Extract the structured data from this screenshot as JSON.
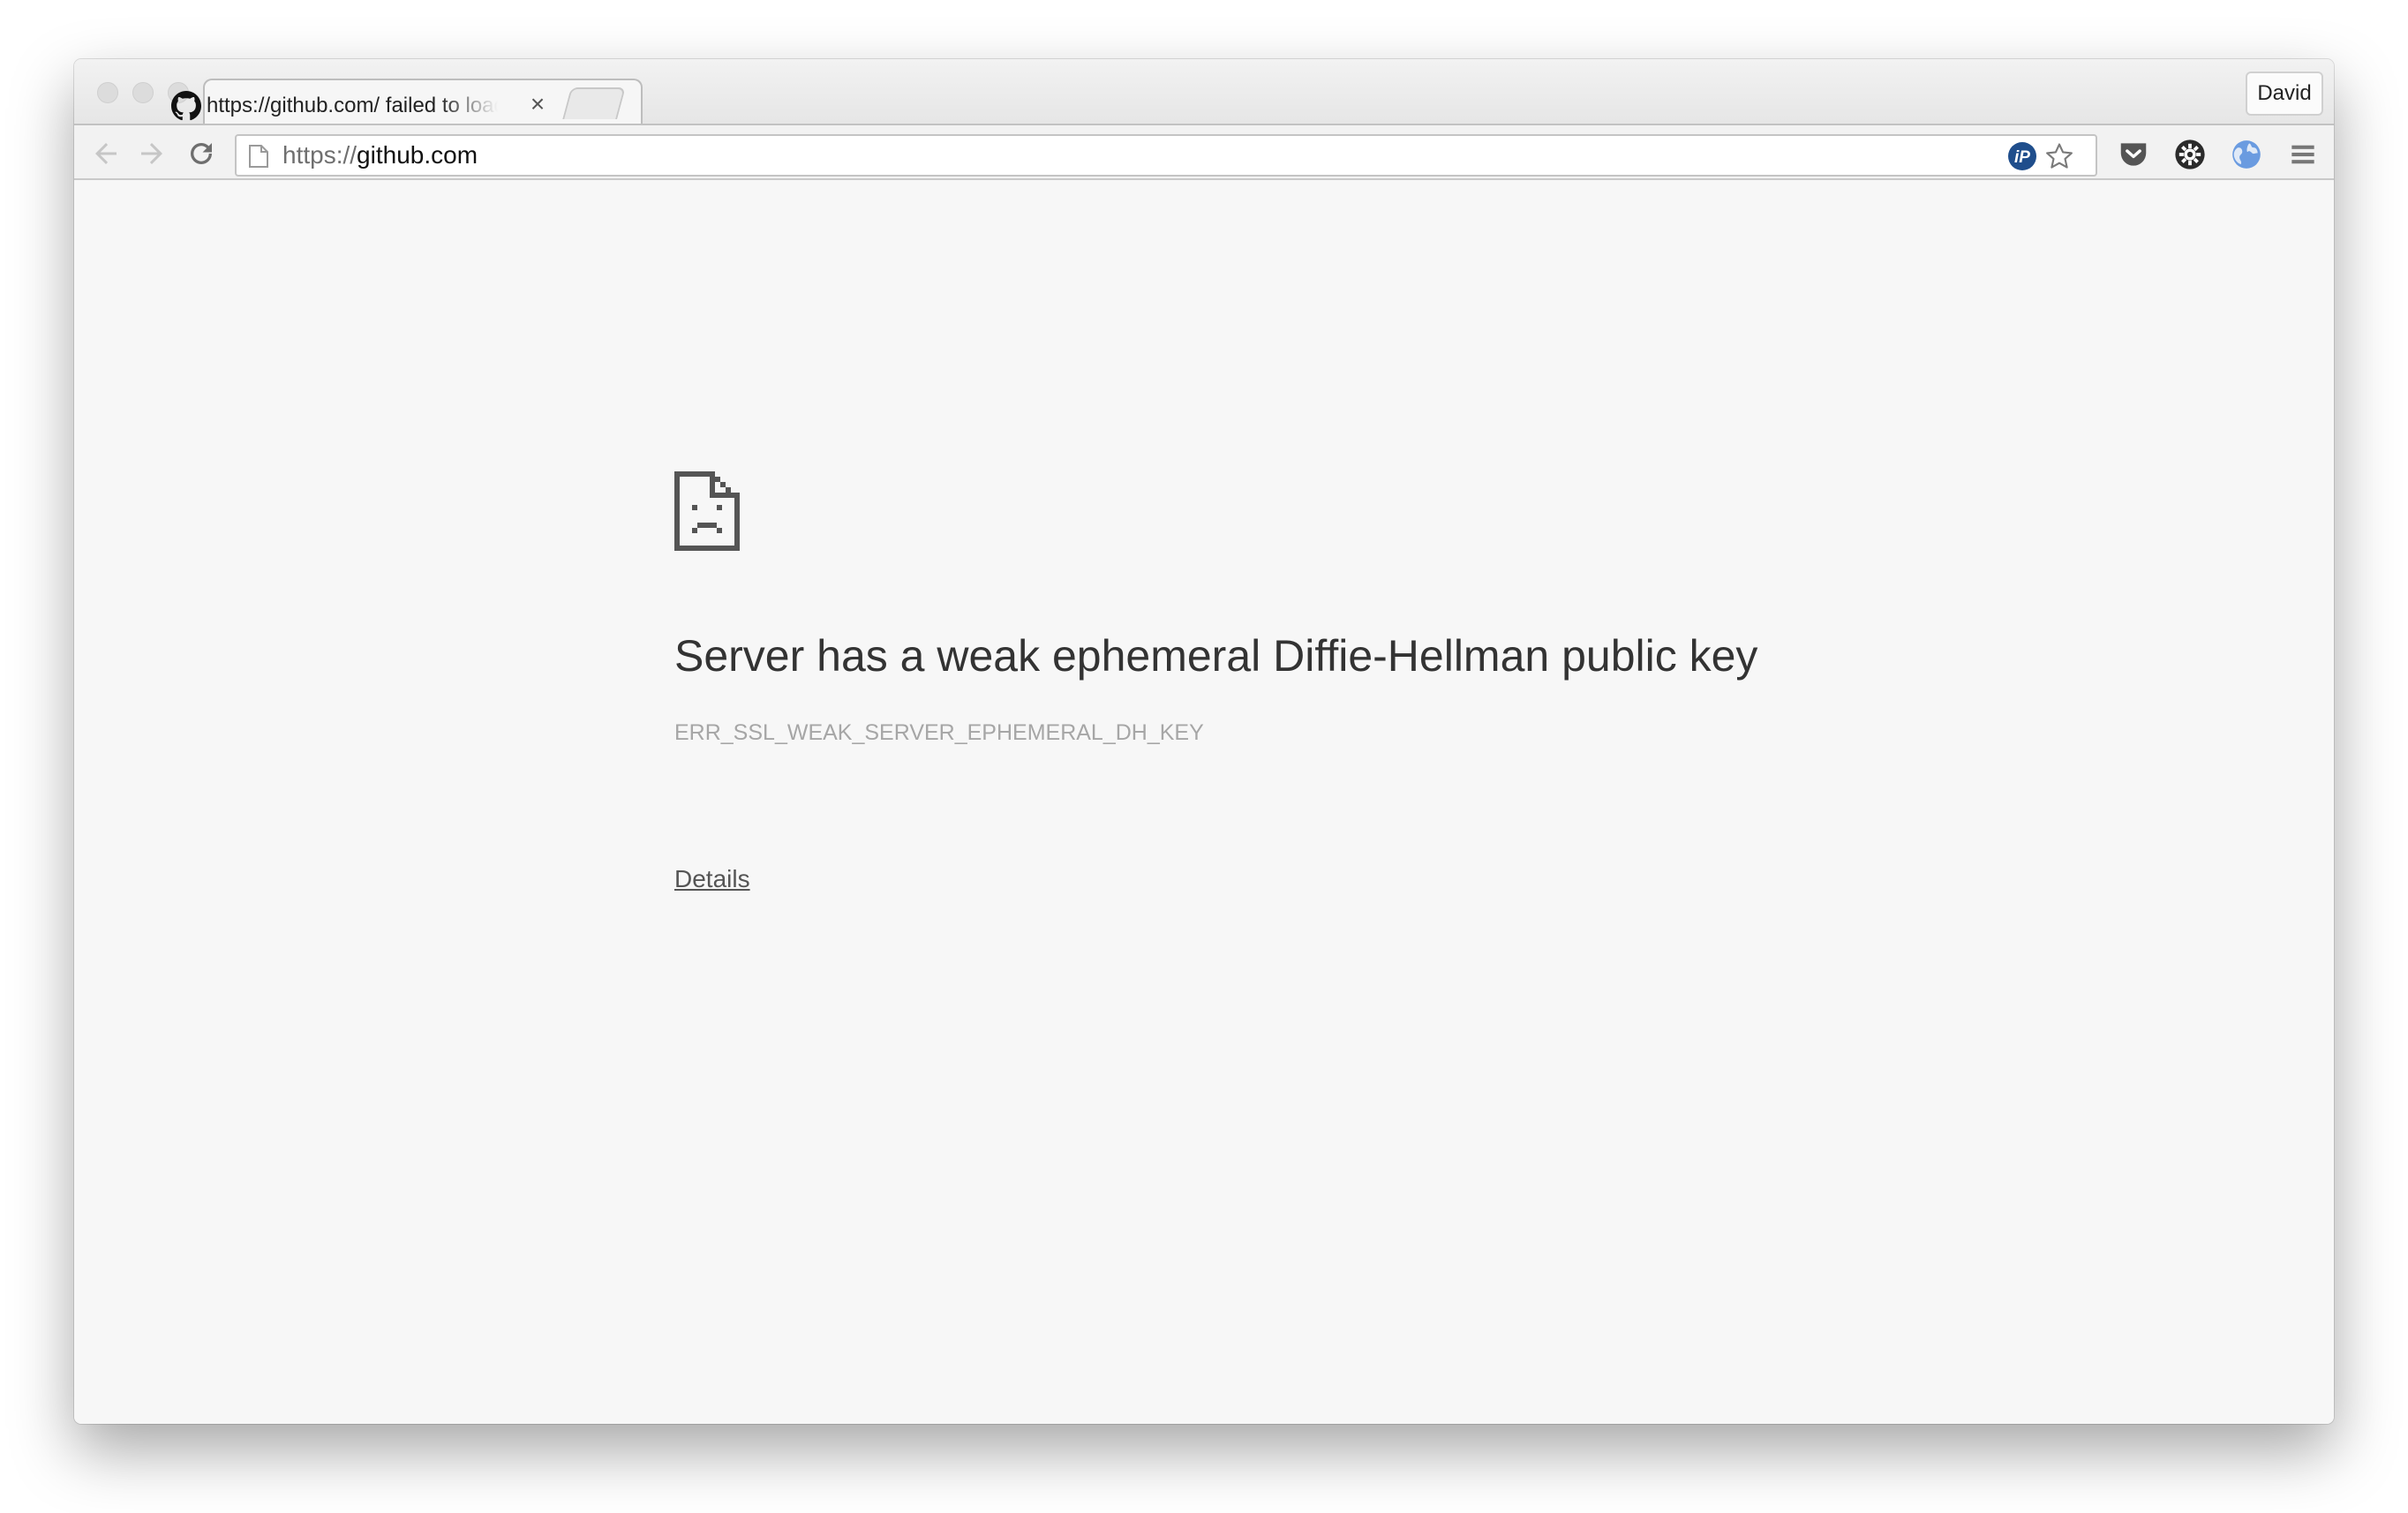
{
  "window": {
    "controls": [
      "close",
      "minimize",
      "zoom"
    ]
  },
  "tabs": [
    {
      "title": "https://github.com/ failed to load",
      "favicon": "github-icon",
      "close_glyph": "×",
      "active": true
    }
  ],
  "profile": {
    "name": "David"
  },
  "toolbar": {
    "back_icon": "arrow-left-icon",
    "forward_icon": "arrow-right-icon",
    "reload_icon": "reload-icon",
    "url_scheme": "https://",
    "url_host": "github.com",
    "omnibox_extensions": [
      "ip-icon",
      "star-icon"
    ],
    "extensions": [
      "pocket-icon",
      "gear-icon",
      "globe-icon",
      "menu-icon"
    ]
  },
  "page": {
    "icon": "sad-document-icon",
    "headline": "Server has a weak ephemeral Diffie-Hellman public key",
    "error_code": "ERR_SSL_WEAK_SERVER_EPHEMERAL_DH_KEY",
    "details_link": "Details"
  },
  "colors": {
    "page_background": "#f7f7f7",
    "headline": "#333333",
    "error_code": "#a6a6a6",
    "ip_badge": "#1f4e8c"
  }
}
